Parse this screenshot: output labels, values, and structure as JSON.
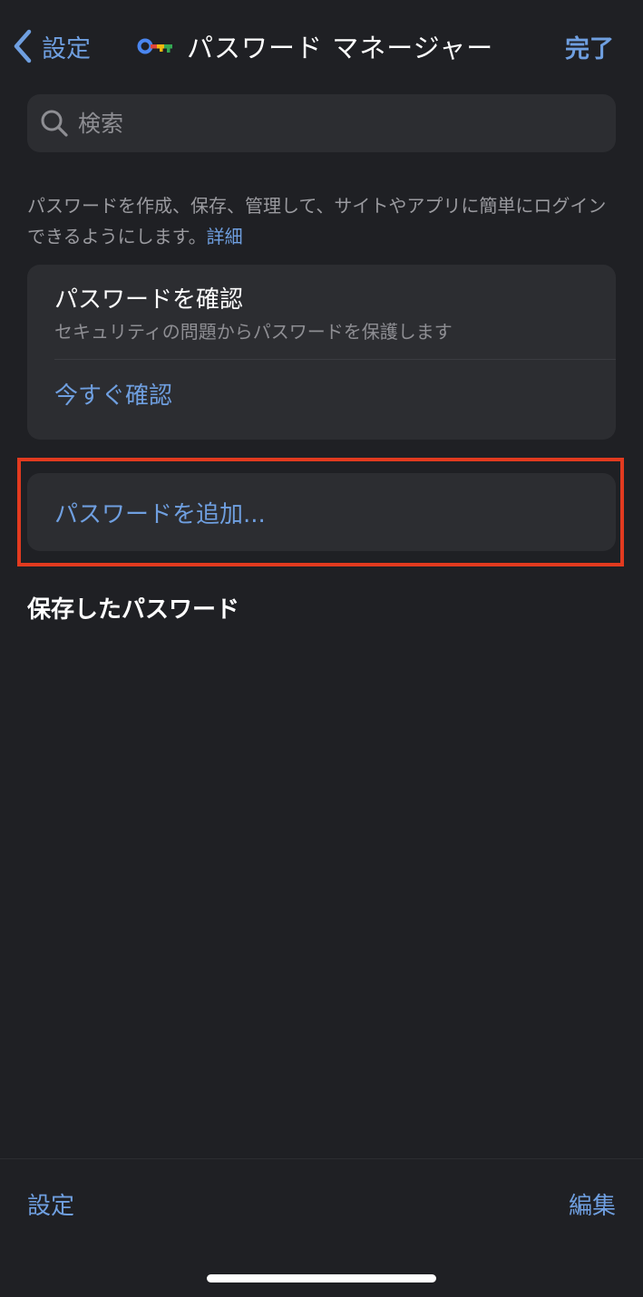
{
  "nav": {
    "back_label": "設定",
    "title": "パスワード マネージャー",
    "done_label": "完了"
  },
  "search": {
    "placeholder": "検索"
  },
  "description": {
    "text": "パスワードを作成、保存、管理して、サイトやアプリに簡単にログインできるようにします。",
    "link": "詳細"
  },
  "check_card": {
    "title": "パスワードを確認",
    "subtitle": "セキュリティの問題からパスワードを保護します",
    "action": "今すぐ確認"
  },
  "add_card": {
    "label": "パスワードを追加..."
  },
  "saved_section": {
    "header": "保存したパスワード"
  },
  "bottom_bar": {
    "left_label": "設定",
    "right_label": "編集"
  },
  "colors": {
    "background": "#1f2024",
    "card": "#2c2d31",
    "accent": "#6f9fe0",
    "highlight": "#e23a1f"
  },
  "icons": {
    "back": "chevron-left-icon",
    "key": "key-icon",
    "search": "search-icon"
  }
}
